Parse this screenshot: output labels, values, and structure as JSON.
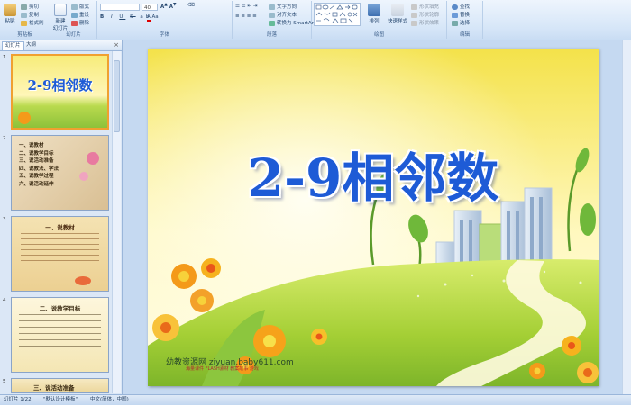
{
  "ribbon": {
    "clipboard": {
      "paste": "粘贴",
      "cut": "剪切",
      "copy": "复制",
      "format_painter": "格式刷",
      "label": "剪贴板"
    },
    "slides": {
      "new_slide": "新建\n幻灯片",
      "layout": "版式",
      "reset": "重设",
      "delete": "删除",
      "label": "幻灯片"
    },
    "font": {
      "size": "40",
      "label": "字体"
    },
    "paragraph": {
      "text_direction": "文字方向",
      "align_text": "对齐文本",
      "smartart": "转换为 SmartArt",
      "label": "段落"
    },
    "drawing": {
      "arrange": "排列",
      "quick_styles": "快速样式",
      "fill": "形状填充",
      "outline": "形状轮廓",
      "effects": "形状效果",
      "label": "绘图"
    },
    "editing": {
      "find": "查找",
      "replace": "替换",
      "select": "选择",
      "label": "编辑"
    }
  },
  "panel": {
    "tabs": [
      "幻灯片",
      "大纲"
    ],
    "slide_numbers": [
      "1",
      "2",
      "3",
      "4",
      "5"
    ],
    "thumb1_title": "2-9相邻数",
    "thumb2_items": [
      "一、说教材",
      "二、说教学目标",
      "三、说活动准备",
      "四、说教法、学法",
      "五、说教学过程",
      "六、说活动延伸"
    ],
    "thumb3_title": "一、说教材",
    "thumb4_title": "二、说教学目标",
    "thumb5_title": "三、说活动准备"
  },
  "slide": {
    "title": "2-9相邻数",
    "watermark_line1": "幼教资源网 ziyuan.baby611.com",
    "watermark_line2": "海量课件 FLASH素材 教案故事 游戏"
  },
  "statusbar": {
    "slide_info": "幻灯片 1/22",
    "theme": "\"默认设计模板\"",
    "language": "中文(简体，中国)"
  },
  "colors": {
    "accent": "#1e5bd6",
    "sky": "#f7e86a",
    "grass": "#a5cf3a",
    "flower": "#f49a1a"
  }
}
